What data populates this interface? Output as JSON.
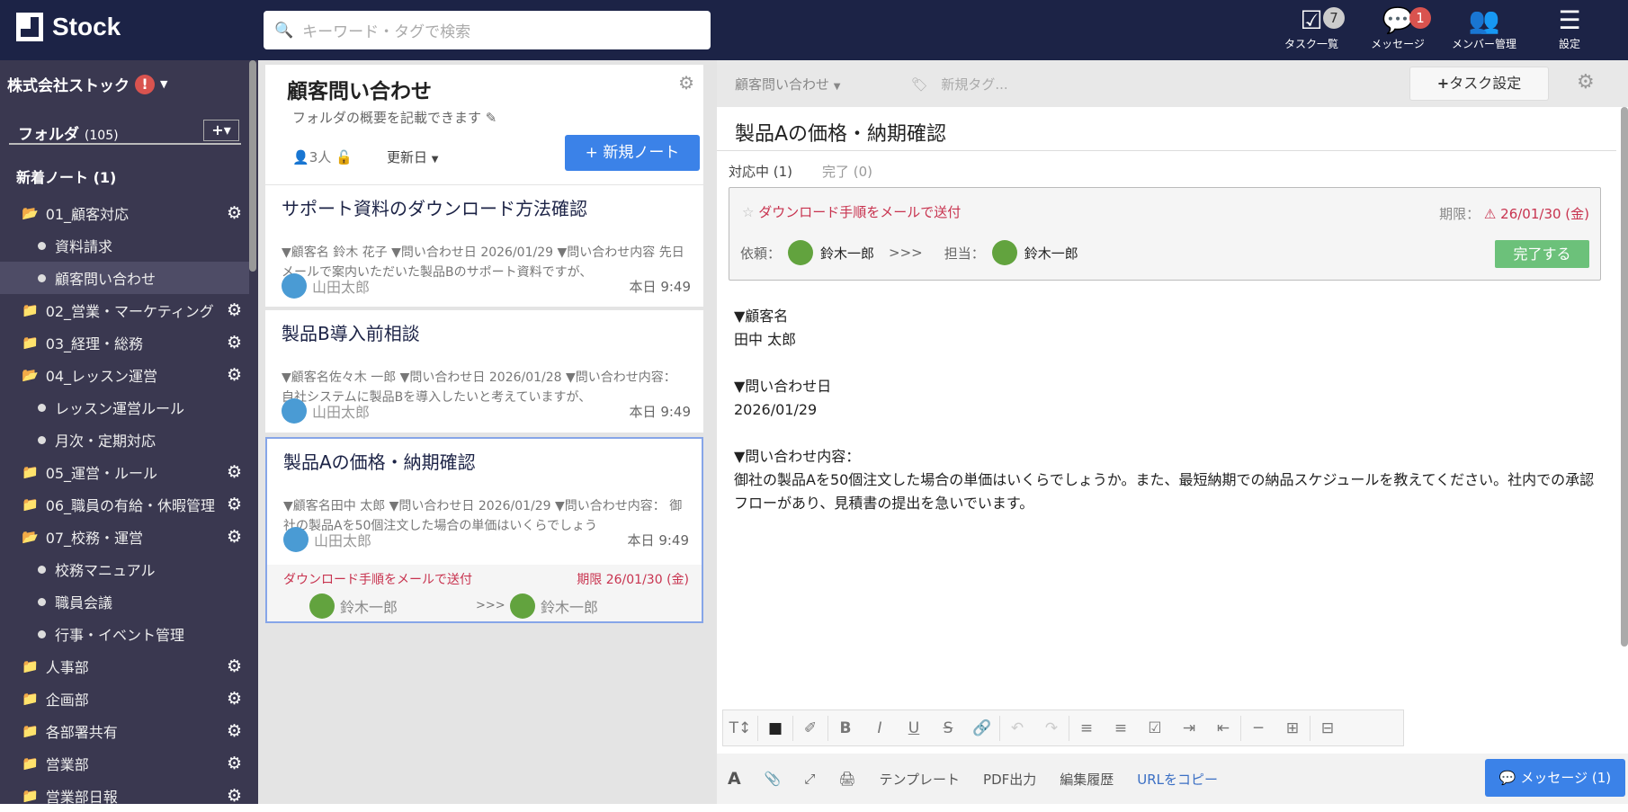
{
  "header": {
    "logo": "Stock",
    "search_placeholder": "キーワード・タグで検索",
    "nav": [
      {
        "label": "タスク一覧",
        "badge": "7"
      },
      {
        "label": "メッセージ",
        "badge": "1"
      },
      {
        "label": "メンバー管理"
      },
      {
        "label": "設定"
      }
    ]
  },
  "sidebar": {
    "company": "株式会社ストック",
    "folders_label": "フォルダ",
    "folders_count": "(105)",
    "new_notes": "新着ノート (1)",
    "items": [
      {
        "type": "folder-open",
        "label": "01_顧客対応",
        "gear": true
      },
      {
        "type": "sub",
        "label": "資料請求"
      },
      {
        "type": "sub",
        "label": "顧客問い合わせ",
        "selected": true
      },
      {
        "type": "folder",
        "label": "02_営業・マーケティング",
        "gear": true
      },
      {
        "type": "folder",
        "label": "03_経理・総務",
        "gear": true
      },
      {
        "type": "folder-open",
        "label": "04_レッスン運営",
        "gear": true
      },
      {
        "type": "sub",
        "label": "レッスン運営ルール"
      },
      {
        "type": "sub",
        "label": "月次・定期対応"
      },
      {
        "type": "folder",
        "label": "05_運営・ルール",
        "gear": true
      },
      {
        "type": "folder",
        "label": "06_職員の有給・休暇管理",
        "gear": true
      },
      {
        "type": "folder-open",
        "label": "07_校務・運営",
        "gear": true
      },
      {
        "type": "sub",
        "label": "校務マニュアル"
      },
      {
        "type": "sub",
        "label": "職員会議"
      },
      {
        "type": "sub",
        "label": "行事・イベント管理"
      },
      {
        "type": "folder",
        "label": "人事部",
        "gear": true
      },
      {
        "type": "folder",
        "label": "企画部",
        "gear": true
      },
      {
        "type": "folder",
        "label": "各部署共有",
        "gear": true
      },
      {
        "type": "folder",
        "label": "営業部",
        "gear": true
      },
      {
        "type": "folder",
        "label": "営業部日報",
        "gear": true
      }
    ]
  },
  "folder": {
    "title": "顧客問い合わせ",
    "description": "フォルダの概要を記載できます",
    "members": "3人",
    "sort": "更新日",
    "new_note": "新規ノート"
  },
  "notes": [
    {
      "title": "サポート資料のダウンロード方法確認",
      "preview": "▼顧客名 鈴木 花子 ▼問い合わせ日 2026/01/29 ▼問い合わせ内容 先日メールで案内いただいた製品Bのサポート資料ですが、",
      "author": "山田太郎",
      "time": "本日 9:49"
    },
    {
      "title": "製品B導入前相談",
      "preview": "▼顧客名佐々木 一郎 ▼問い合わせ日 2026/01/28 ▼問い合わせ内容： 自社システムに製品Bを導入したいと考えていますが、",
      "author": "山田太郎",
      "time": "本日 9:49"
    },
    {
      "title": "製品Aの価格・納期確認",
      "preview": "▼顧客名田中 太郎 ▼問い合わせ日 2026/01/29 ▼問い合わせ内容： 御社の製品Aを50個注文した場合の単価はいくらでしょう",
      "author": "山田太郎",
      "time": "本日 9:49",
      "task": {
        "title": "ダウンロード手順をメールで送付",
        "due": "期限 26/01/30 (金)",
        "from": "鈴木一郎",
        "arrow": ">>>",
        "to": "鈴木一郎"
      }
    }
  ],
  "detail": {
    "folder": "顧客問い合わせ",
    "tag_placeholder": "新規タグ...",
    "task_setting": "タスク設定",
    "title": "製品Aの価格・納期確認",
    "tabs": [
      "対応中 (1)",
      "完了 (0)"
    ],
    "task": {
      "title": "ダウンロード手順をメールで送付",
      "due_label": "期限：",
      "due": "26/01/30 (金)",
      "request_label": "依頼：",
      "requester": "鈴木一郎",
      "arrow": ">>>",
      "assignee_label": "担当：",
      "assignee": "鈴木一郎",
      "complete": "完了する"
    },
    "body": "▼顧客名\n田中 太郎\n\n▼問い合わせ日\n2026/01/29\n\n▼問い合わせ内容：\n御社の製品Aを50個注文した場合の単価はいくらでしょうか。また、最短納期での納品スケジュールを教えてください。社内での承認フローがあり、見積書の提出を急いでいます。",
    "bottom": {
      "template": "テンプレート",
      "pdf": "PDF出力",
      "history": "編集履歴",
      "copy_url": "URLをコピー",
      "message": "メッセージ (1)"
    }
  },
  "colors": {
    "header": "#1c2346",
    "sidebar": "#3a3850",
    "accent": "#3b82e8",
    "danger": "#c8334f",
    "success": "#6cc17a"
  }
}
